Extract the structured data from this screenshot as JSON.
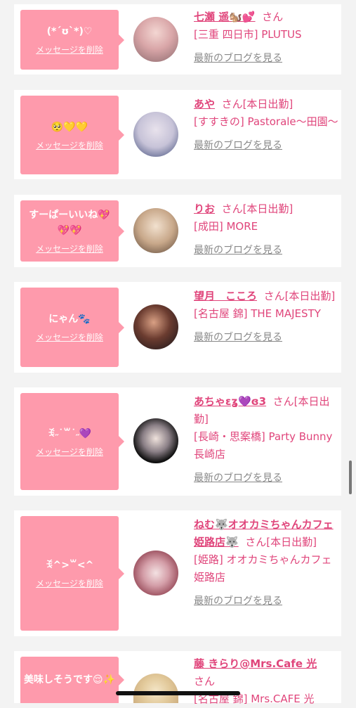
{
  "delete_label": "メッセージを削除",
  "blog_label": "最新のブログを見る",
  "cards": [
    {
      "message": "(*´ʊ`*)♡",
      "name": "七瀬 遥🐿️💕",
      "suffix": "さん",
      "shop": "[三重 四日市] PLUTUS"
    },
    {
      "message": "🥺💛💛",
      "name": "あや",
      "suffix": "さん[本日出勤]",
      "shop": "[すすきの] Pastorale〜田園〜"
    },
    {
      "message": "すーぱーいいね💖💖💖",
      "name": "りお",
      "suffix": "さん[本日出勤]",
      "shop": "[成田] MORE"
    },
    {
      "message": "にゃん🐾",
      "name": "望月　こころ",
      "suffix": "さん[本日出勤]",
      "shop": "[名古屋 錦] THE MAJESTY"
    },
    {
      "message": "ꉂ˶˙꒳˙˶💜",
      "name": "あちゃεʓ💜ɞ3",
      "suffix": "さん[本日出勤]",
      "shop": "[長崎・思案橋] Party Bunny 長崎店"
    },
    {
      "message": "ꉂ^>꒳<^",
      "name": "ねむ🐺オオカミちゃんカフェ姫路店🐺",
      "suffix": "さん[本日出勤]",
      "shop": "[姫路] オオカミちゃんカフェ姫路店"
    },
    {
      "message": "美味しそうです😌✨",
      "name": "藤 きらり@Mrs.Cafe 光",
      "suffix": "さん",
      "shop": "[名古屋 錦] Mrs.CAFE 光"
    }
  ],
  "colors": {
    "bubble": "#fe9aac",
    "accent": "#e0457b",
    "background": "#f3f3f3"
  }
}
